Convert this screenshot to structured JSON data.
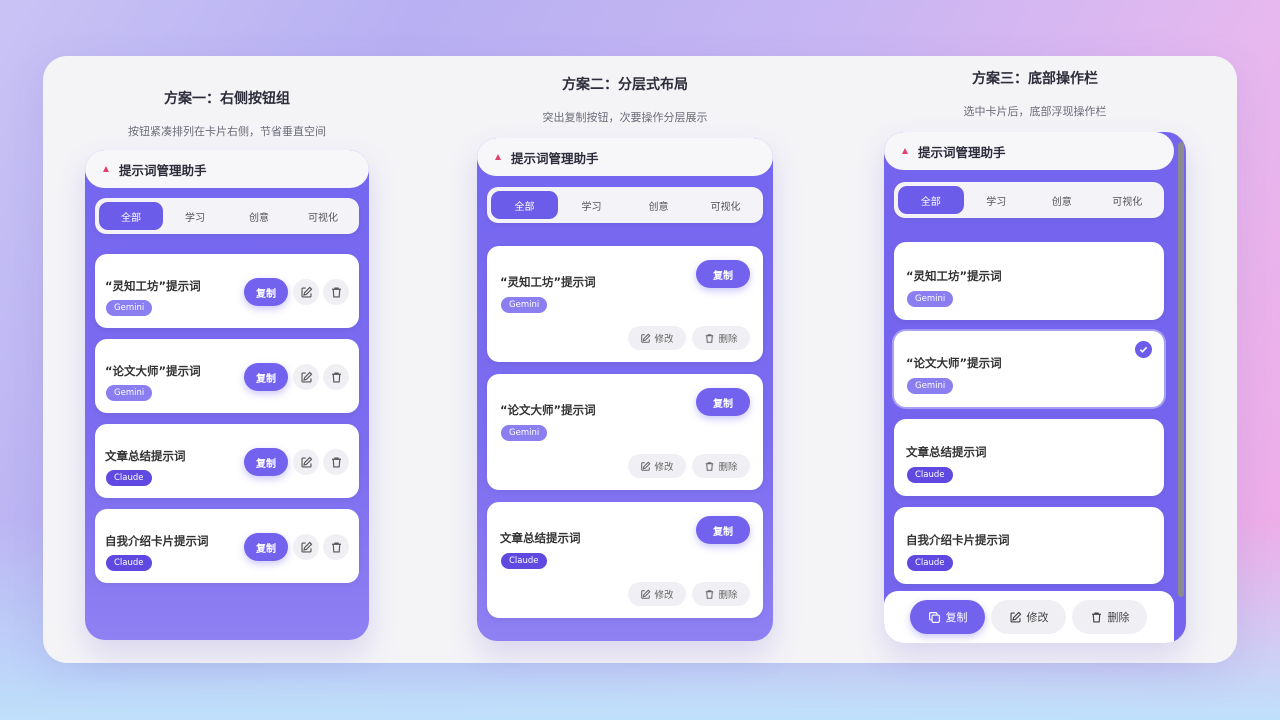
{
  "colors": {
    "accent": "#6b5ce9",
    "gemini_badge": "#8b7ef0",
    "claude_badge": "#5f49e0",
    "logo": "#e0406a"
  },
  "app_title": "提示词管理助手",
  "tabs": [
    "全部",
    "学习",
    "创意",
    "可视化"
  ],
  "active_tab": "全部",
  "prompts": [
    {
      "title": "“灵知工坊”提示词",
      "tag": "Gemini"
    },
    {
      "title": "“论文大师”提示词",
      "tag": "Gemini"
    },
    {
      "title": "文章总结提示词",
      "tag": "Claude"
    },
    {
      "title": "自我介绍卡片提示词",
      "tag": "Claude"
    }
  ],
  "actions": {
    "copy": "复制",
    "edit": "修改",
    "delete": "删除"
  },
  "schemes": [
    {
      "title": "方案一：右侧按钮组",
      "subtitle": "按钮紧凑排列在卡片右侧，节省垂直空间"
    },
    {
      "title": "方案二：分层式布局",
      "subtitle": "突出复制按钮，次要操作分层展示"
    },
    {
      "title": "方案三：底部操作栏",
      "subtitle": "选中卡片后，底部浮现操作栏"
    }
  ],
  "icons": {
    "logo": "triangle-logo-icon",
    "edit": "pencil-square-icon",
    "delete": "trash-icon",
    "copy": "copy-icon",
    "selected": "check-icon"
  }
}
